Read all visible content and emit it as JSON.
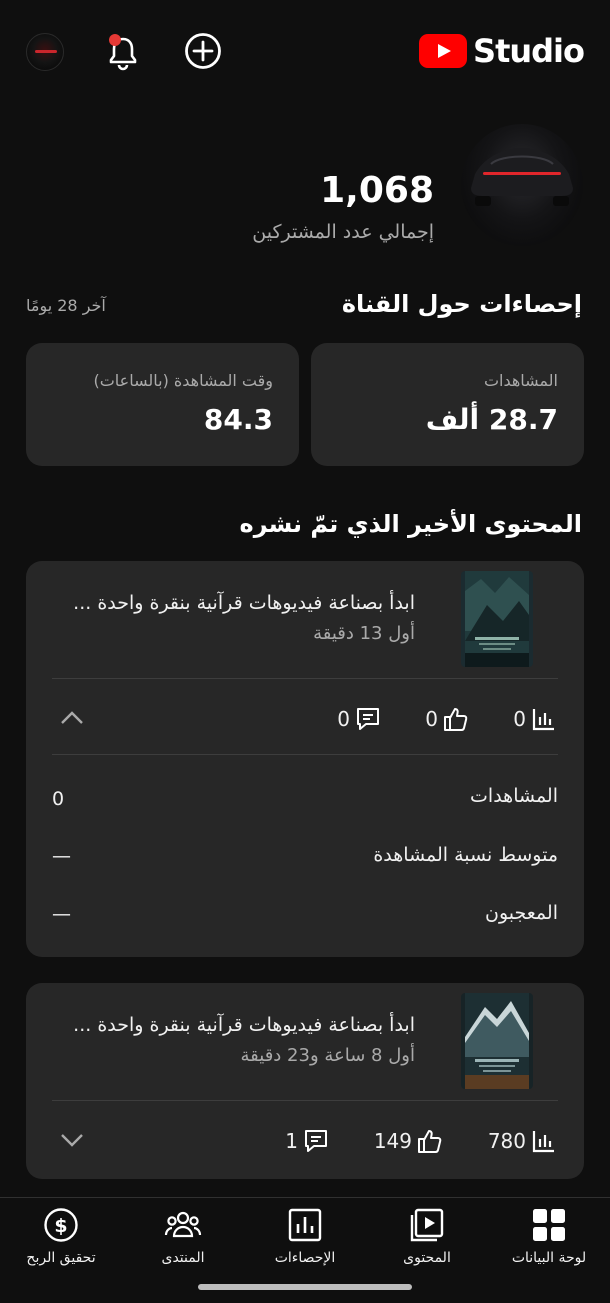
{
  "app": {
    "brand": "Studio",
    "accent": "#ff0000"
  },
  "header": {
    "icons": [
      "avatar",
      "bell-icon",
      "create-icon"
    ],
    "subscribers_count": "1,068",
    "subscribers_label": "إجمالي عدد المشتركين"
  },
  "analytics": {
    "title": "إحصاءات حول القناة",
    "period": "آخر 28 يومًا",
    "cards": [
      {
        "label": "المشاهدات",
        "value": "28.7 ألف"
      },
      {
        "label": "وقت المشاهدة (بالساعات)",
        "value": "84.3"
      }
    ]
  },
  "recent": {
    "title": "المحتوى الأخير الذي تمّ نشره",
    "items": [
      {
        "title": "ابدأ بصناعة فيديوهات قرآنية بنقرة واحدة ...",
        "age": "أول 13 دقيقة",
        "views": "0",
        "likes": "0",
        "comments": "0",
        "expanded": true,
        "details": [
          {
            "label": "المشاهدات",
            "value": "0"
          },
          {
            "label": "متوسط نسبة المشاهدة",
            "value": "—"
          },
          {
            "label": "المعجبون",
            "value": "—"
          }
        ]
      },
      {
        "title": "ابدأ بصناعة فيديوهات قرآنية بنقرة واحدة ...",
        "age": "أول 8 ساعة و23 دقيقة",
        "views": "780",
        "likes": "149",
        "comments": "1",
        "expanded": false
      }
    ]
  },
  "bottom_nav": [
    {
      "label": "لوحة البيانات",
      "icon": "dashboard-icon"
    },
    {
      "label": "المحتوى",
      "icon": "content-icon"
    },
    {
      "label": "الإحصاءات",
      "icon": "analytics-icon"
    },
    {
      "label": "المنتدى",
      "icon": "community-icon"
    },
    {
      "label": "تحقيق الربح",
      "icon": "earn-icon"
    }
  ]
}
